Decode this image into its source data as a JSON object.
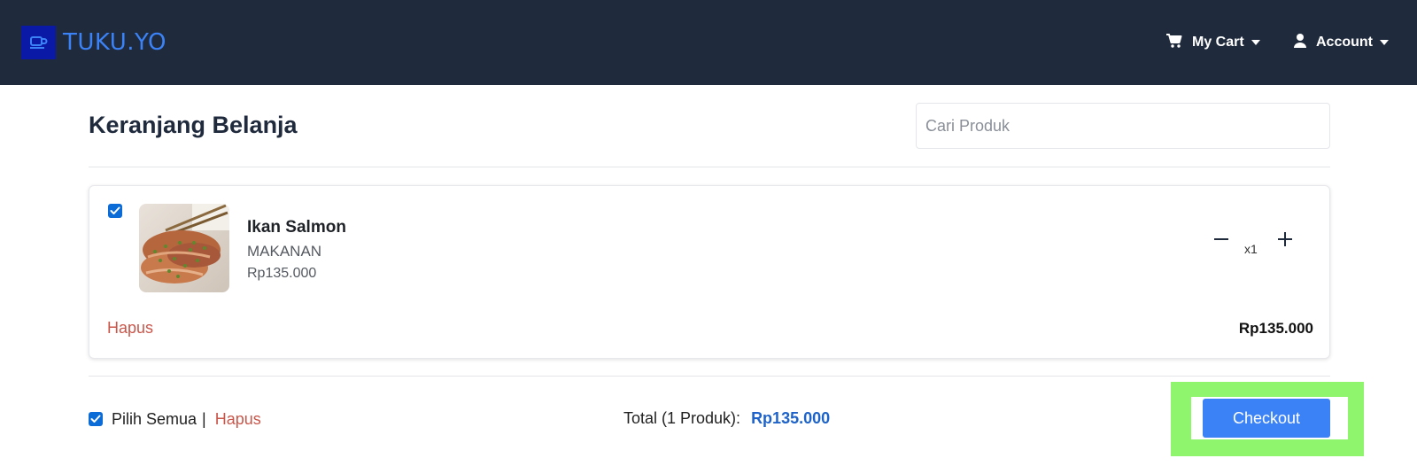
{
  "brand": {
    "name": "TUKU.YO"
  },
  "nav": {
    "cart_label": "My Cart",
    "account_label": "Account"
  },
  "page": {
    "title": "Keranjang Belanja"
  },
  "search": {
    "placeholder": "Cari Produk",
    "value": ""
  },
  "cart": {
    "items": [
      {
        "checked": true,
        "name": "Ikan Salmon",
        "category": "MAKANAN",
        "price": "Rp135.000",
        "quantity": "x1",
        "line_total": "Rp135.000",
        "remove_label": "Hapus"
      }
    ]
  },
  "footer": {
    "select_all_checked": true,
    "select_all_label": "Pilih Semua",
    "separator": "|",
    "remove_label": "Hapus",
    "total_label": "Total (1 Produk):",
    "total_value": "Rp135.000",
    "checkout_label": "Checkout"
  },
  "colors": {
    "navbar_bg": "#1f2a3c",
    "brand_text": "#3b82f6",
    "logo_bg": "#0a1aa6",
    "remove_text": "#c0392b",
    "total_value": "#1e63c9",
    "checkout_bg": "#3b82f6",
    "checkout_highlight": "#8ff56c"
  },
  "icons": {
    "logo": "coffee-cup-icon",
    "cart": "cart-icon",
    "account": "user-icon",
    "caret": "caret-down-icon",
    "minus": "minus-icon",
    "plus": "plus-icon",
    "check": "check-icon"
  }
}
